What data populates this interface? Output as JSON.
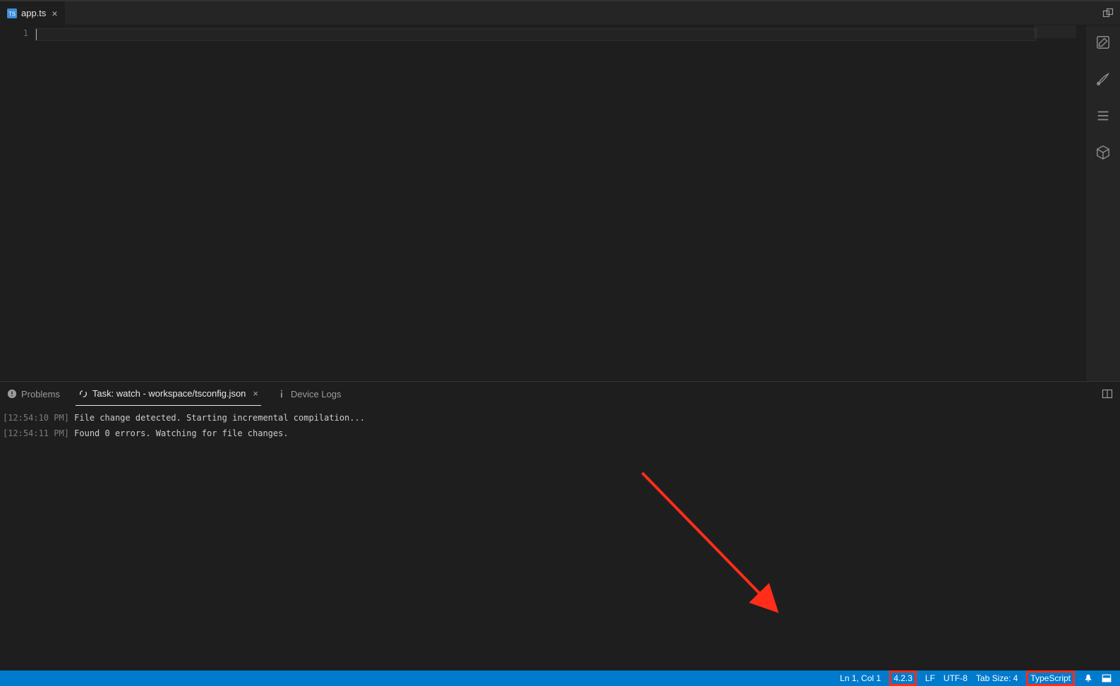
{
  "tabs": {
    "active": {
      "label": "app.ts"
    }
  },
  "editor": {
    "line_number": "1"
  },
  "panel": {
    "tabs": {
      "problems": "Problems",
      "task": "Task: watch - workspace/tsconfig.json",
      "device_logs": "Device Logs"
    },
    "log": {
      "line1_ts": "[12:54:10 PM]",
      "line1_msg": " File change detected. Starting incremental compilation...",
      "line2_ts": "[12:54:11 PM]",
      "line2_msg": " Found 0 errors. Watching for file changes."
    }
  },
  "statusbar": {
    "ln_col": "Ln 1, Col 1",
    "ts_version": "4.2.3",
    "eol_partial": "LF",
    "encoding": "UTF-8",
    "tab_size": "Tab Size: 4",
    "language": "TypeScript"
  }
}
